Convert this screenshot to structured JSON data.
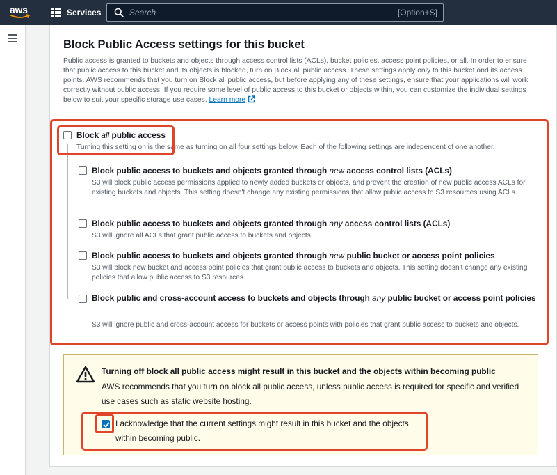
{
  "nav": {
    "logo_text": "aws",
    "services_label": "Services",
    "search_placeholder": "Search",
    "search_shortcut": "[Option+S]"
  },
  "section": {
    "title": "Block Public Access settings for this bucket",
    "description": "Public access is granted to buckets and objects through access control lists (ACLs), bucket policies, access point policies, or all. In order to ensure that public access to this bucket and its objects is blocked, turn on Block all public access. These settings apply only to this bucket and its access points. AWS recommends that you turn on Block all public access, but before applying any of these settings, ensure that your applications will work correctly without public access. If you require some level of public access to this bucket or objects within, you can customize the individual settings below to suit your specific storage use cases.",
    "learn_more": "Learn more"
  },
  "block_all": {
    "label_prefix": "Block",
    "label_em": "all",
    "label_suffix": "public access",
    "description": "Turning this setting on is the same as turning on all four settings below. Each of the following settings are independent of one another.",
    "checked": false
  },
  "options": [
    {
      "prefix": "Block public access to buckets and objects granted through",
      "em": "new",
      "suffix": "access control lists (ACLs)",
      "description": "S3 will block public access permissions applied to newly added buckets or objects, and prevent the creation of new public access ACLs for existing buckets and objects. This setting doesn't change any existing permissions that allow public access to S3 resources using ACLs.",
      "checked": false
    },
    {
      "prefix": "Block public access to buckets and objects granted through",
      "em": "any",
      "suffix": "access control lists (ACLs)",
      "description": "S3 will ignore all ACLs that grant public access to buckets and objects.",
      "checked": false
    },
    {
      "prefix": "Block public access to buckets and objects granted through",
      "em": "new",
      "suffix": "public bucket or access point policies",
      "description": "S3 will block new bucket and access point policies that grant public access to buckets and objects. This setting doesn't change any existing policies that allow public access to S3 resources.",
      "checked": false
    },
    {
      "prefix": "Block public and cross-account access to buckets and objects through",
      "em": "any",
      "suffix": "public bucket or access point policies",
      "description": "S3 will ignore public and cross-account access for buckets or access points with policies that grant public access to buckets and objects.",
      "checked": false
    }
  ],
  "warning": {
    "title": "Turning off block all public access might result in this bucket and the objects within becoming public",
    "text": "AWS recommends that you turn on block all public access, unless public access is required for specific and verified use cases such as static website hosting.",
    "ack_label": "I acknowledge that the current settings might result in this bucket and the objects within becoming public.",
    "ack_checked": true
  },
  "colors": {
    "nav_bg": "#232f3e",
    "highlight_red": "#e0452a",
    "link_blue": "#0073bb",
    "warning_bg": "#fffce9"
  }
}
